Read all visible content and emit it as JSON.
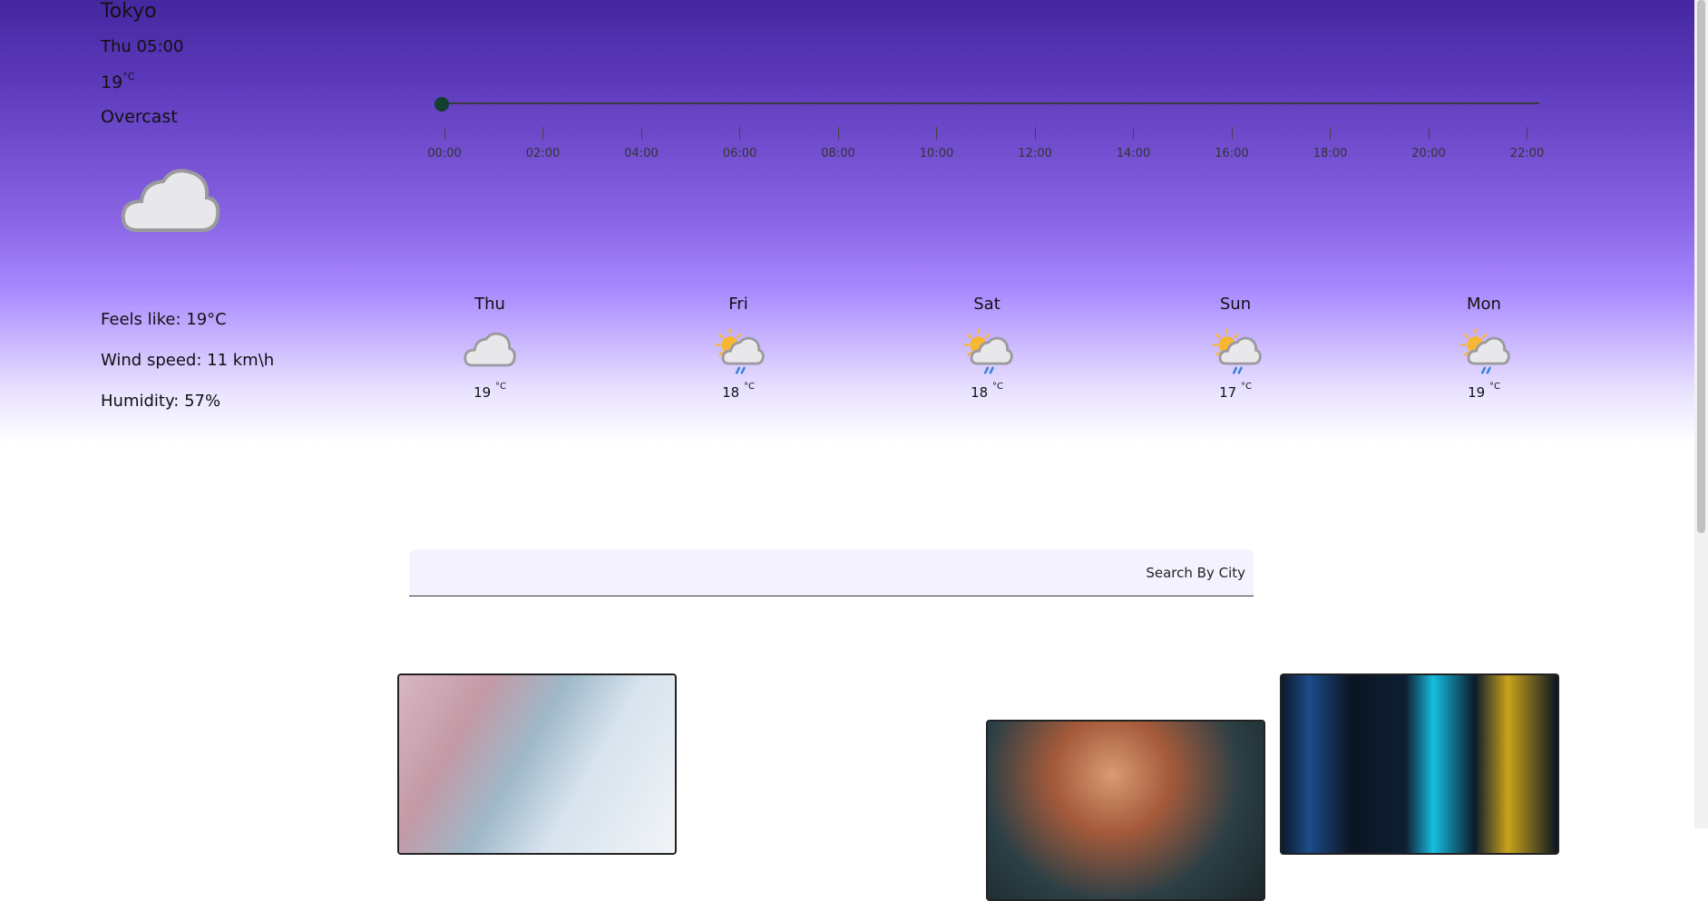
{
  "current": {
    "city": "Tokyo",
    "datetime": "Thu 05:00",
    "temp": "19",
    "temp_unit": "°C",
    "condition": "Overcast",
    "icon": "cloud-icon",
    "feels_like": "Feels like: 19°C",
    "wind_speed": "Wind speed: 11 km\\h",
    "humidity": "Humidity: 57%"
  },
  "timeline": {
    "value_fraction": 0,
    "ticks": [
      "00:00",
      "02:00",
      "04:00",
      "06:00",
      "08:00",
      "10:00",
      "12:00",
      "14:00",
      "16:00",
      "18:00",
      "20:00",
      "22:00"
    ]
  },
  "forecast": [
    {
      "day": "Thu",
      "temp": "19",
      "unit": "°C",
      "icon": "cloud-icon"
    },
    {
      "day": "Fri",
      "temp": "18",
      "unit": "°C",
      "icon": "sun-cloud-rain-icon"
    },
    {
      "day": "Sat",
      "temp": "18",
      "unit": "°C",
      "icon": "sun-cloud-rain-icon"
    },
    {
      "day": "Sun",
      "temp": "17",
      "unit": "°C",
      "icon": "sun-cloud-rain-icon"
    },
    {
      "day": "Mon",
      "temp": "19",
      "unit": "°C",
      "icon": "sun-cloud-rain-icon"
    }
  ],
  "search": {
    "placeholder": "Search By City",
    "value": ""
  },
  "colors": {
    "hero_top": "#4527a0",
    "hero_mid": "#a888ff",
    "slider_thumb": "#123f2e",
    "search_bg": "#f5f2ff"
  }
}
